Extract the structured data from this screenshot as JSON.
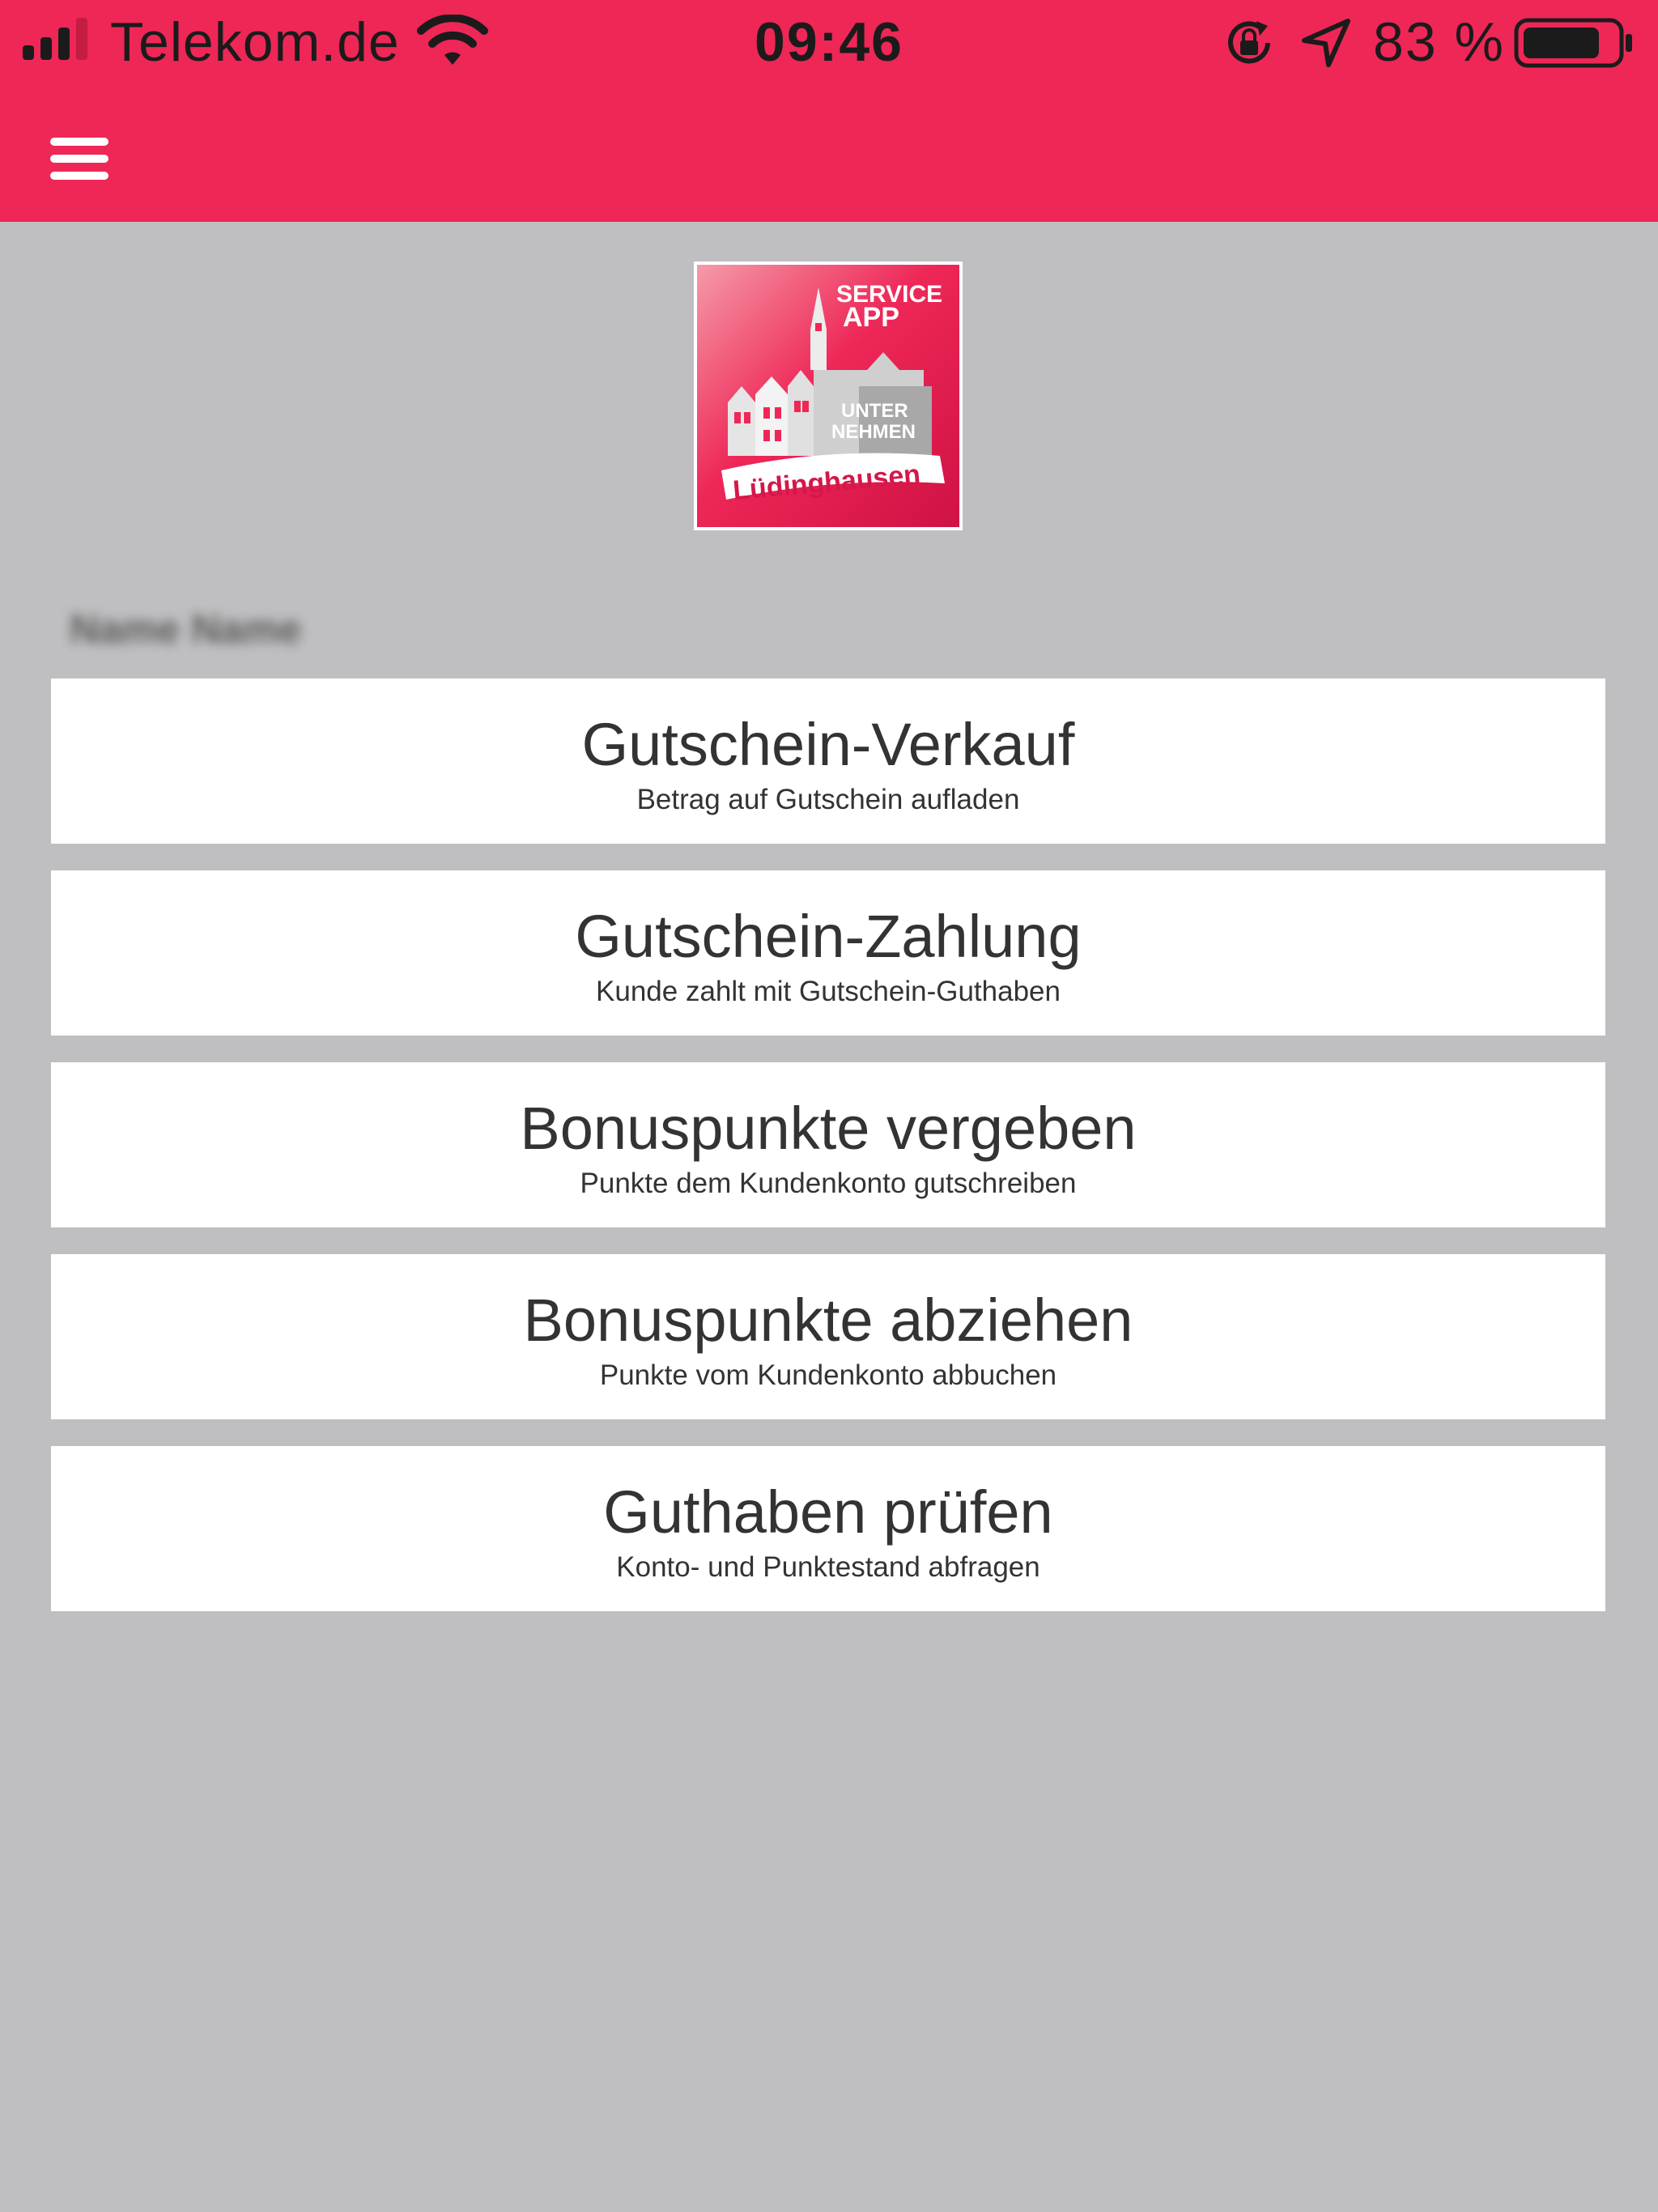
{
  "status_bar": {
    "carrier": "Telekom.de",
    "time": "09:46",
    "battery_percent": "83 %",
    "battery_level": 0.83,
    "signal_bars": 4,
    "icons": [
      "signal-icon",
      "wifi-icon",
      "rotation-lock-icon",
      "location-arrow-icon",
      "battery-icon"
    ]
  },
  "header": {
    "background_color": "#ee2757",
    "menu_icon": "hamburger-menu-icon"
  },
  "logo": {
    "line1": "SERVICE",
    "line2": "APP",
    "line3": "UNTER",
    "line4": "NEHMEN",
    "town": "Lüdinghausen"
  },
  "user": {
    "name": "Name Name"
  },
  "actions": [
    {
      "title": "Gutschein-Verkauf",
      "subtitle": "Betrag auf Gutschein aufladen"
    },
    {
      "title": "Gutschein-Zahlung",
      "subtitle": "Kunde zahlt mit Gutschein-Guthaben"
    },
    {
      "title": "Bonuspunkte vergeben",
      "subtitle": "Punkte dem Kundenkonto gutschreiben"
    },
    {
      "title": "Bonuspunkte abziehen",
      "subtitle": "Punkte vom Kundenkonto abbuchen"
    },
    {
      "title": "Guthaben prüfen",
      "subtitle": "Konto- und Punktestand abfragen"
    }
  ],
  "colors": {
    "accent": "#ee2757",
    "page_background": "#bfbfc1",
    "card_background": "#ffffff",
    "text": "#333333"
  }
}
